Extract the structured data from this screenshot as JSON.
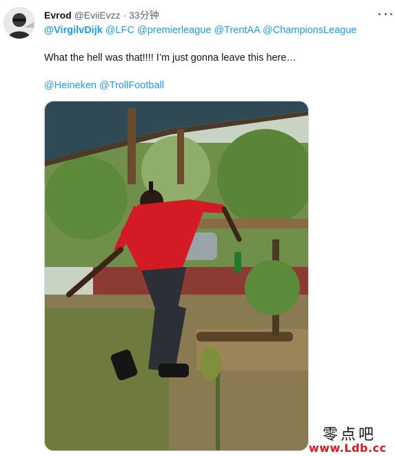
{
  "tweet": {
    "author": {
      "display_name": "Evrod",
      "handle": "@EviiEvzz",
      "separator": "·",
      "timestamp": "33分钟"
    },
    "reply_to": [
      "@VirgilvDijk",
      "@LFC",
      "@premierleague",
      "@TrentAA",
      "@ChampionsLeague"
    ],
    "text": "What the hell was that!!!! I’m just gonna leave this here…",
    "tags": [
      "@Heineken",
      "@TrollFootball"
    ],
    "icons": {
      "avatar": "avatar-photo",
      "more": "more-horizontal-icon"
    }
  },
  "watermark": {
    "chinese": "零点吧",
    "url": "www.Ldb.cc"
  },
  "colors": {
    "link": "#1d9bf0",
    "text": "#0f1419",
    "muted": "#536471",
    "watermark_red": "#e0141e"
  }
}
